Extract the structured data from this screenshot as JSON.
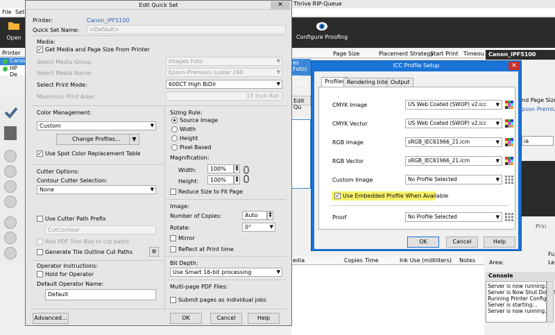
{
  "app": {
    "menu": [
      "File",
      "Setu"
    ],
    "title_fragment": "Thrive RIP-Queue",
    "toolbar": {
      "open_label": "Open",
      "configure_label": "Configure Proofing"
    },
    "printer_panel_header": "Printer",
    "printers": [
      "Canon",
      "HP De"
    ],
    "queue_columns": [
      "Page Size",
      "Placement Strategy",
      "Start Print",
      "Timeou"
    ],
    "queue_fragments": [
      "es Foto)",
      "es Foto)",
      "Edit Qu"
    ],
    "right_panel": {
      "header": "Canon_iPF5100",
      "fragments": [
        "nd Page Size",
        "pson Premium Lu",
        "ia",
        "Prin",
        "Fu",
        "Le"
      ],
      "area_label": "Area:"
    },
    "jobs_columns": [
      "edia",
      "Copies",
      "Time",
      "Ink Use (milliliters)",
      "Notes"
    ],
    "console": {
      "title": "Console",
      "lines": [
        "Server is now running...",
        "Server is Now Shut Down!",
        "Running Printer Config...",
        "Server is starting...",
        "Server is now running..."
      ]
    }
  },
  "quickset": {
    "title": "Edit Quick Set",
    "close": "✕",
    "printer_label": "Printer:",
    "printer_value": "Canon_iPF5100",
    "name_label": "Quick Set Name:",
    "name_value": "<Default>",
    "media_label": "Media:",
    "get_media_label": "Get Media and Page Size From Printer",
    "media_group_label": "Select Media Group:",
    "media_group_value": "Images Foto",
    "media_name_label": "Select Media Name:",
    "media_name_value": "Epson Premium Luster 260",
    "print_mode_label": "Select Print Mode:",
    "print_mode_value": "600CT High BiDir",
    "max_area_label": "Maximum Print Area:",
    "max_area_value": "17 Inch Roll",
    "color_mgmt_label": "Color Management:",
    "color_mgmt_value": "Custom",
    "change_profiles_label": "Change Profiles...",
    "spot_color_label": "Use Spot Color Replacement Table",
    "cutter_options_label": "Cutter Options:",
    "contour_label": "Contour Cutter Selection:",
    "contour_value": "None",
    "cutter_prefix_label": "Use Cutter Path Prefix",
    "cut_contour_value": "CutContour",
    "pdf_trim_label": "Add PDF Trim Box to cut paths",
    "tile_outline_label": "Generate Tile Outline Cut Paths",
    "operator_instr_label": "Operator Instructions:",
    "hold_label": "Hold for Operator",
    "default_operator_label": "Default Operator Name:",
    "default_operator_value": "Default",
    "advanced_label": "Advanced...",
    "sizing_rule_label": "Sizing Rule:",
    "sizing_options": [
      "Source Image",
      "Width",
      "Height",
      "Pixel Based"
    ],
    "magnification_label": "Magnification:",
    "width_label": "Width:",
    "width_value": "100%",
    "height_label": "Height:",
    "height_value": "100%",
    "reduce_label": "Reduce Size to Fit Page",
    "image_label": "Image:",
    "copies_label": "Number of Copies:",
    "copies_value": "Auto",
    "rotate_label": "Rotate:",
    "rotate_value": "0°",
    "mirror_label": "Mirror",
    "reflect_label": "Reflect at Print time",
    "bit_depth_label": "Bit Depth:",
    "bit_depth_value": "Use Smart 16-bit processing",
    "multipage_label": "Multi-page PDF Files:",
    "submit_pages_label": "Submit pages as individual jobs",
    "ok_label": "OK",
    "cancel_label": "Cancel",
    "help_label": "Help"
  },
  "icc": {
    "title": "ICC Profile Setup",
    "close": "✕",
    "tabs": [
      "Profiles",
      "Rendering Intents",
      "Output"
    ],
    "rows": [
      {
        "label": "CMYK Image",
        "value": "US Web Coated (SWOP) v2.icc"
      },
      {
        "label": "CMYK Vector",
        "value": "US Web Coated (SWOP) v2.icc"
      },
      {
        "label": "RGB Image",
        "value": "sRGB_IEC61966_21.icm"
      },
      {
        "label": "RGB Vector",
        "value": "sRGB_IEC61966_21.icm"
      },
      {
        "label": "Custom Image",
        "value": "No Profile Selected"
      }
    ],
    "embedded_label": "Use Embedded Profile When Available",
    "proof_label": "Proof",
    "proof_value": "No Profile Selected",
    "ok_label": "OK",
    "cancel_label": "Cancel",
    "help_label": "Help"
  },
  "colors": {
    "highlight": "#f7f26b",
    "accent": "#1a73d6",
    "toolbar": "#2b2b2b"
  }
}
